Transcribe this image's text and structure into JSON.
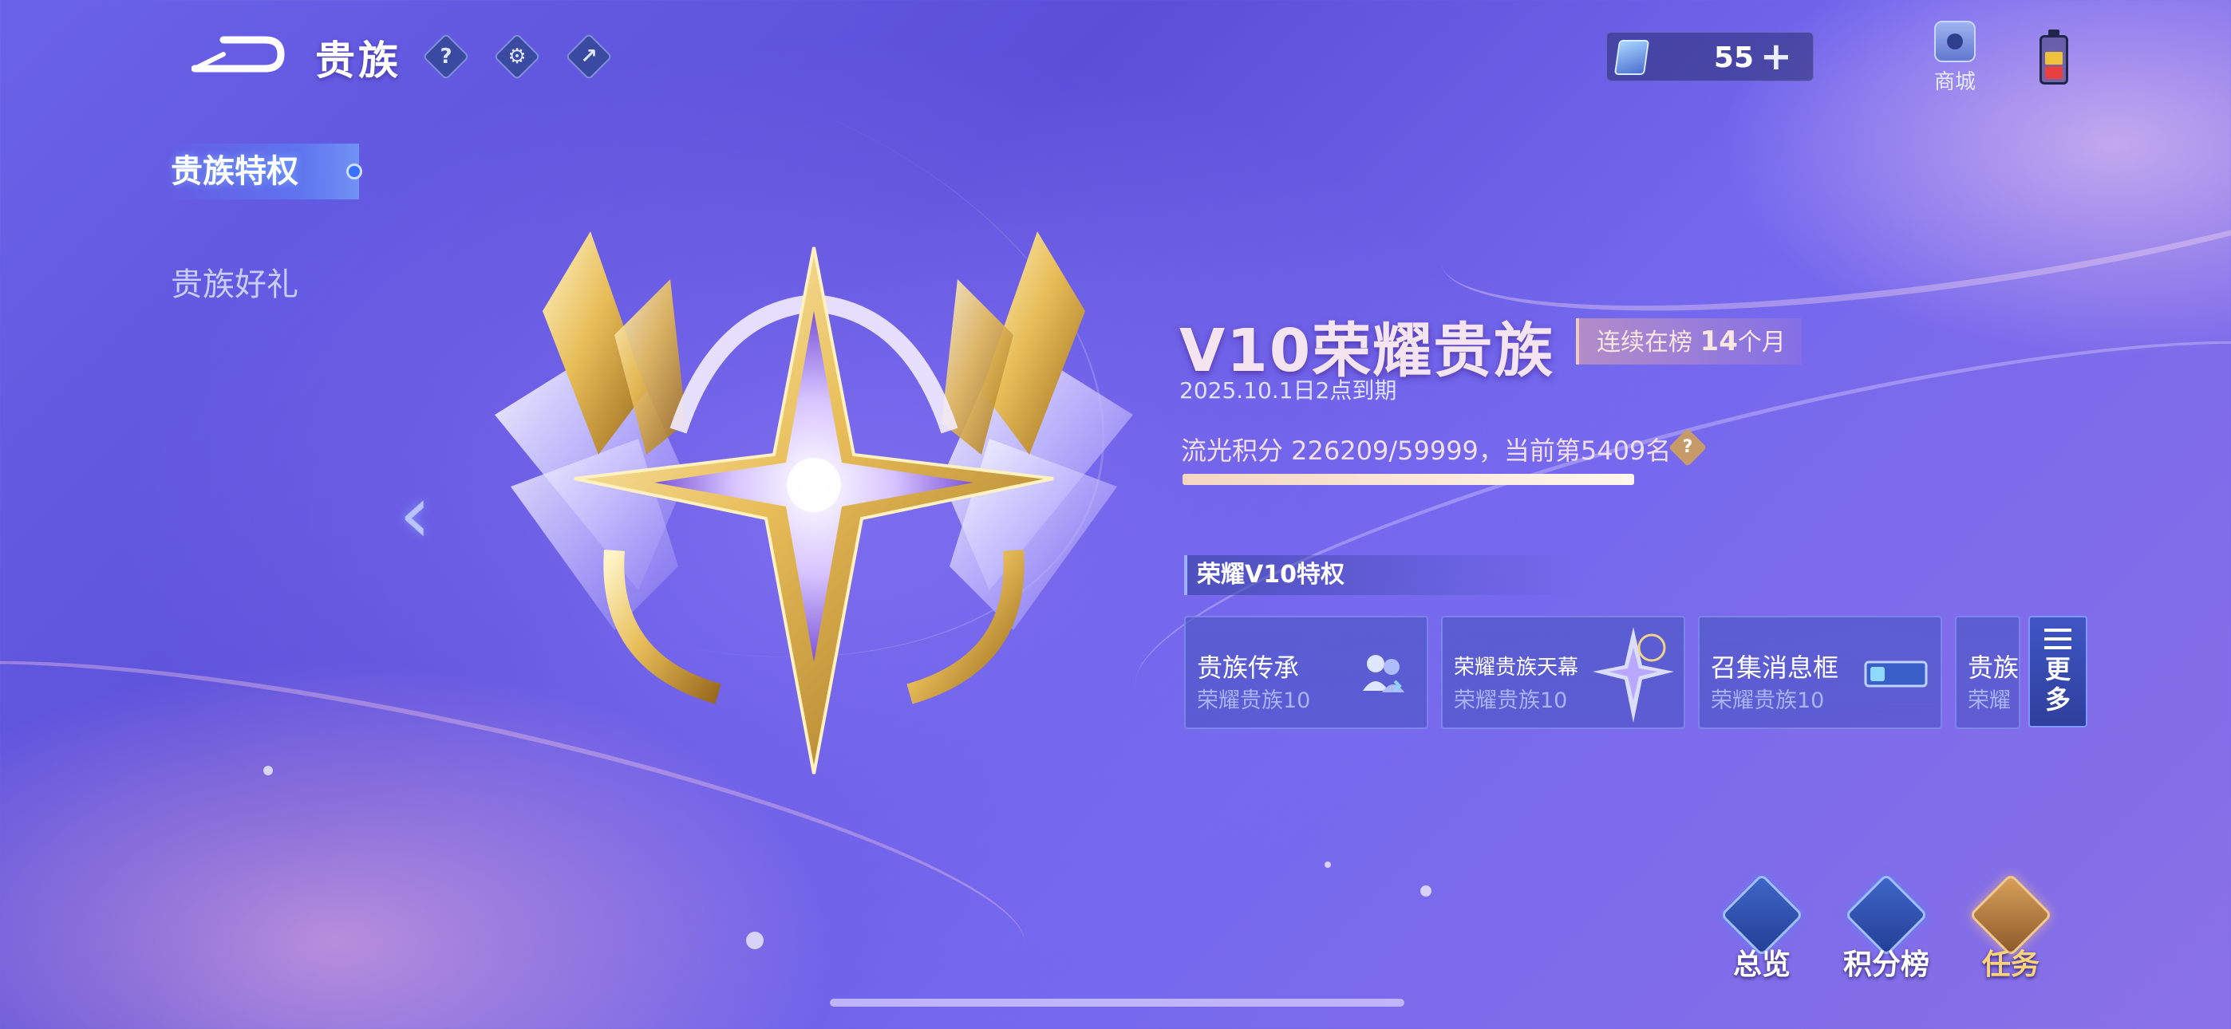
{
  "header": {
    "title": "贵族",
    "icons": [
      "help-icon",
      "settings-icon",
      "share-icon"
    ],
    "currency": {
      "icon": "card-icon",
      "value": "55",
      "add_label": "+"
    },
    "shop_label": "商城"
  },
  "sidebar": {
    "items": [
      {
        "label": "贵族特权",
        "active": true
      },
      {
        "label": "贵族好礼",
        "active": false
      }
    ]
  },
  "noble": {
    "level_title": "V10荣耀贵族",
    "streak_prefix": "连续在榜 ",
    "streak_count": "14",
    "streak_suffix": "个月",
    "expire_text": "2025.10.1日2点到期",
    "points_text": "流光积分 226209/59999，当前第5409名",
    "points_help_icon": "?",
    "progress_fraction": 1.0
  },
  "perks": {
    "section_title": "荣耀V10特权",
    "items": [
      {
        "name": "贵族传承",
        "sub": "荣耀贵族10",
        "icon": "inherit-icon"
      },
      {
        "name": "荣耀贵族天幕",
        "sub": "荣耀贵族10",
        "icon": "sky-curtain-icon"
      },
      {
        "name": "召集消息框",
        "sub": "荣耀贵族10",
        "icon": "message-frame-icon"
      },
      {
        "name": "贵族",
        "sub": "荣耀",
        "icon": ""
      }
    ],
    "more_label": "更多"
  },
  "bottom_actions": [
    {
      "label": "总览",
      "icon": "overview-icon"
    },
    {
      "label": "积分榜",
      "icon": "leaderboard-icon"
    },
    {
      "label": "任务",
      "icon": "task-icon"
    }
  ],
  "colors": {
    "background": "#6a62e8",
    "accent_gold": "#d9a15a",
    "task_label": "#ffd37a",
    "nav_active": "#3a70ff"
  }
}
